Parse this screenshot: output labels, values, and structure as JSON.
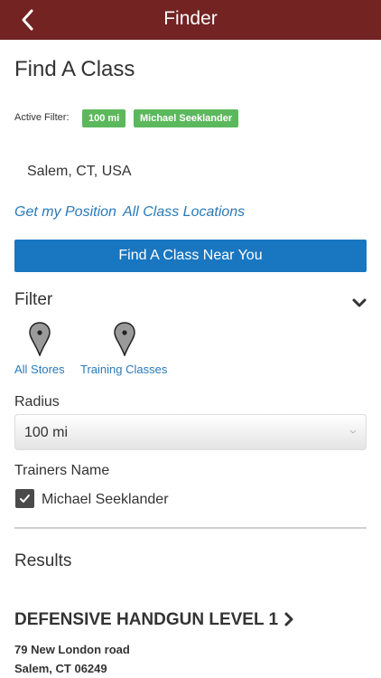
{
  "header": {
    "title": "Finder",
    "back_icon": "chevron-left-icon",
    "bar_color": "#722322"
  },
  "page": {
    "title": "Find A Class"
  },
  "active_filter": {
    "label": "Active Filter:",
    "badges": [
      "100 mi",
      "Michael Seeklander"
    ],
    "badge_color": "#5cb85c"
  },
  "location": {
    "text": "Salem, CT, USA"
  },
  "links": {
    "get_position": "Get my Position",
    "all_locations": "All Class Locations",
    "color": "#2a7ab8"
  },
  "primary_button": {
    "label": "Find A Class Near You",
    "color": "#1976c0"
  },
  "filter": {
    "heading": "Filter",
    "toggle_icon": "chevron-down-icon",
    "types": [
      {
        "label": "All Stores",
        "icon": "map-pin-icon"
      },
      {
        "label": "Training Classes",
        "icon": "map-pin-icon"
      }
    ],
    "radius": {
      "label": "Radius",
      "selected": "100 mi"
    },
    "trainers": {
      "label": "Trainers Name",
      "items": [
        {
          "name": "Michael Seeklander",
          "checked": true
        }
      ]
    }
  },
  "results": {
    "heading": "Results",
    "items": [
      {
        "title": "DEFENSIVE HANDGUN LEVEL 1",
        "address_line1": "79 New London road",
        "address_line2": "Salem, CT 06249"
      }
    ]
  }
}
